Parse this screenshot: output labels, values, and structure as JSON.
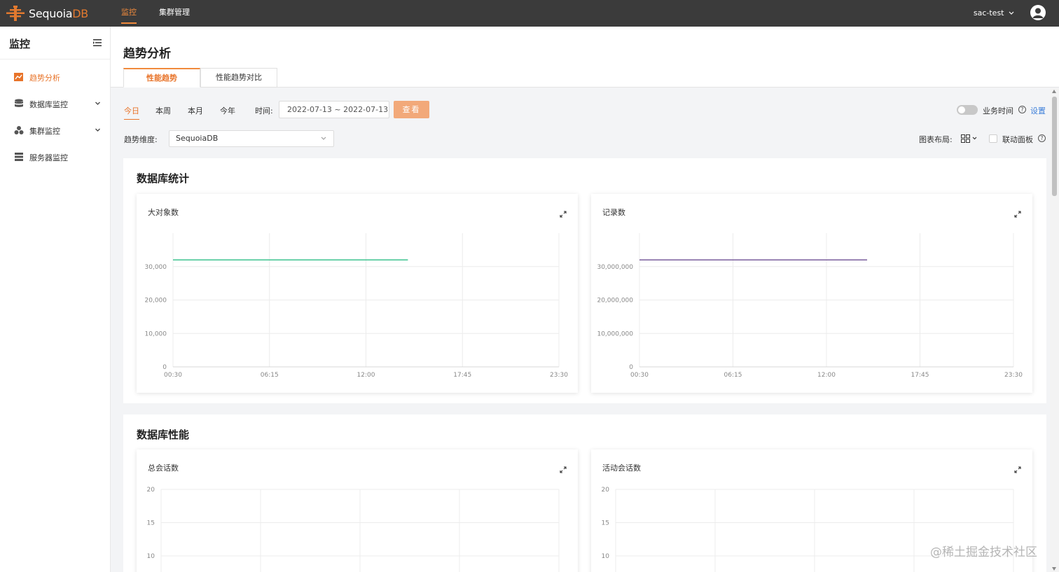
{
  "topbar": {
    "logo_main": "Sequoia",
    "logo_accent": "DB",
    "nav": [
      "监控",
      "集群管理"
    ],
    "user": "sac-test"
  },
  "sidebar": {
    "title": "监控",
    "items": [
      {
        "label": "趋势分析",
        "icon": "trend-chart-icon",
        "active": true
      },
      {
        "label": "数据库监控",
        "icon": "database-icon"
      },
      {
        "label": "集群监控",
        "icon": "cluster-icon"
      },
      {
        "label": "服务器监控",
        "icon": "server-icon"
      }
    ]
  },
  "page": {
    "title": "趋势分析",
    "tabs": [
      "性能趋势",
      "性能趋势对比"
    ]
  },
  "filters": {
    "quick": [
      "今日",
      "本周",
      "本月",
      "今年"
    ],
    "time_label": "时间:",
    "date_range": "2022-07-13 ~ 2022-07-13",
    "view_btn": "查看",
    "business_time": "业务时间",
    "settings": "设置",
    "dimension_label": "趋势维度:",
    "dimension_value": "SequoiaDB",
    "layout_label": "图表布局:",
    "linked_panel": "联动面板"
  },
  "sections": [
    {
      "title": "数据库统计"
    },
    {
      "title": "数据库性能"
    }
  ],
  "colors": {
    "accent": "#f08a3c",
    "green_line": "#3dc38f",
    "purple_line": "#7a5e9c"
  },
  "chart_data": [
    {
      "type": "line",
      "title": "大对象数",
      "x_ticks": [
        "00:30",
        "06:15",
        "12:00",
        "17:45",
        "23:30"
      ],
      "y_ticks": [
        "0",
        "10,000",
        "20,000",
        "30,000"
      ],
      "ylim": [
        0,
        40000
      ],
      "series": [
        {
          "x": [
            "00:30",
            "14:30"
          ],
          "values": [
            32000,
            32000
          ],
          "color": "#3dc38f"
        }
      ]
    },
    {
      "type": "line",
      "title": "记录数",
      "x_ticks": [
        "00:30",
        "06:15",
        "12:00",
        "17:45",
        "23:30"
      ],
      "y_ticks": [
        "0",
        "10,000,000",
        "20,000,000",
        "30,000,000"
      ],
      "ylim": [
        0,
        40000000
      ],
      "series": [
        {
          "x": [
            "00:30",
            "14:30"
          ],
          "values": [
            32000000,
            32000000
          ],
          "color": "#7a5e9c"
        }
      ]
    },
    {
      "type": "line",
      "title": "总会话数",
      "y_ticks": [
        "10",
        "15",
        "20"
      ],
      "ylim": [
        0,
        20
      ],
      "series": []
    },
    {
      "type": "line",
      "title": "活动会话数",
      "y_ticks": [
        "10",
        "15",
        "20"
      ],
      "ylim": [
        0,
        20
      ],
      "series": []
    }
  ],
  "watermark": "@稀土掘金技术社区"
}
